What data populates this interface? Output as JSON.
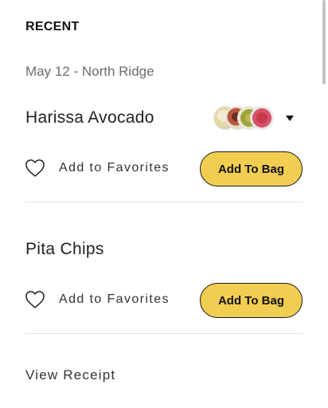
{
  "section": {
    "heading": "RECENT"
  },
  "order": {
    "meta": "May 12 - North Ridge"
  },
  "items": [
    {
      "name": "Harissa Avocado",
      "favorite_label": "Add to Favorites",
      "add_label": "Add To Bag",
      "ingredient_thumbs": [
        "ingredient-thumb",
        "ingredient-thumb",
        "ingredient-thumb",
        "ingredient-thumb"
      ],
      "has_dropdown": true
    },
    {
      "name": "Pita Chips",
      "favorite_label": "Add to Favorites",
      "add_label": "Add To Bag"
    }
  ],
  "footer": {
    "view_receipt_label": "View Receipt"
  },
  "colors": {
    "accent_button": "#f1cd52",
    "muted_text": "#6b6b6b",
    "divider": "#e3e3e3"
  },
  "icons": {
    "favorite": "heart-outline-icon",
    "dropdown": "caret-down-icon"
  }
}
